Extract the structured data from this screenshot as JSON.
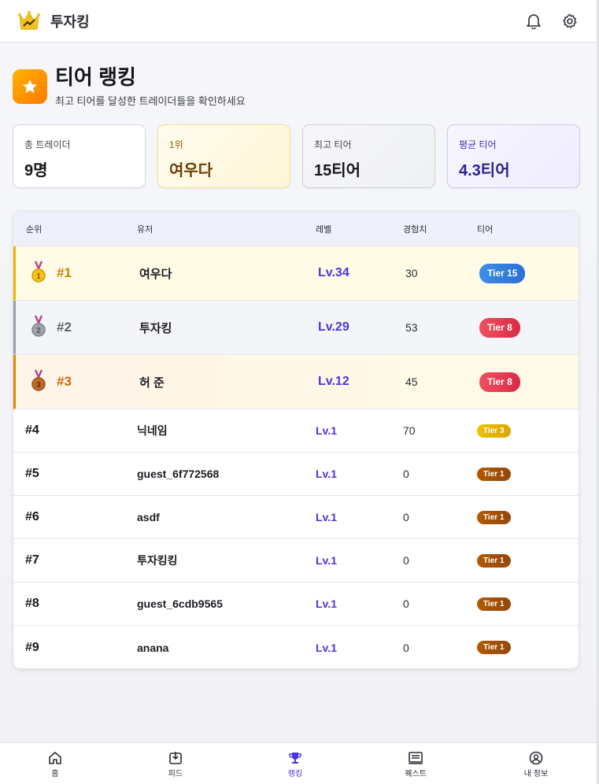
{
  "header": {
    "app_title": "투자킹"
  },
  "page": {
    "title": "티어 랭킹",
    "subtitle": "최고 티어를 달성한 트레이더들을 확인하세요"
  },
  "stats": [
    {
      "label": "총 트레이더",
      "value": "9명"
    },
    {
      "label": "1위",
      "value": "여우다"
    },
    {
      "label": "최고 티어",
      "value": "15티어"
    },
    {
      "label": "평균 티어",
      "value": "4.3티어"
    }
  ],
  "table": {
    "headers": {
      "rank": "순위",
      "user": "유저",
      "level": "레벨",
      "exp": "경험치",
      "tier": "티어"
    },
    "rows": [
      {
        "rank": "#1",
        "medal": "1",
        "user": "여우다",
        "level": "Lv.34",
        "exp": "30",
        "tier": "Tier 15"
      },
      {
        "rank": "#2",
        "medal": "2",
        "user": "투자킹",
        "level": "Lv.29",
        "exp": "53",
        "tier": "Tier 8"
      },
      {
        "rank": "#3",
        "medal": "3",
        "user": "허 준",
        "level": "Lv.12",
        "exp": "45",
        "tier": "Tier 8"
      },
      {
        "rank": "#4",
        "user": "닉네임",
        "level": "Lv.1",
        "exp": "70",
        "tier": "Tier 3"
      },
      {
        "rank": "#5",
        "user": "guest_6f772568",
        "level": "Lv.1",
        "exp": "0",
        "tier": "Tier 1"
      },
      {
        "rank": "#6",
        "user": "asdf",
        "level": "Lv.1",
        "exp": "0",
        "tier": "Tier 1"
      },
      {
        "rank": "#7",
        "user": "투자킹킹",
        "level": "Lv.1",
        "exp": "0",
        "tier": "Tier 1"
      },
      {
        "rank": "#8",
        "user": "guest_6cdb9565",
        "level": "Lv.1",
        "exp": "0",
        "tier": "Tier 1"
      },
      {
        "rank": "#9",
        "user": "anana",
        "level": "Lv.1",
        "exp": "0",
        "tier": "Tier 1"
      }
    ]
  },
  "nav": [
    {
      "label": "홈",
      "icon": "home-icon"
    },
    {
      "label": "피드",
      "icon": "feed-icon"
    },
    {
      "label": "랭킹",
      "icon": "trophy-icon",
      "active": true
    },
    {
      "label": "퀘스트",
      "icon": "quest-icon"
    },
    {
      "label": "내 정보",
      "icon": "profile-icon"
    }
  ]
}
